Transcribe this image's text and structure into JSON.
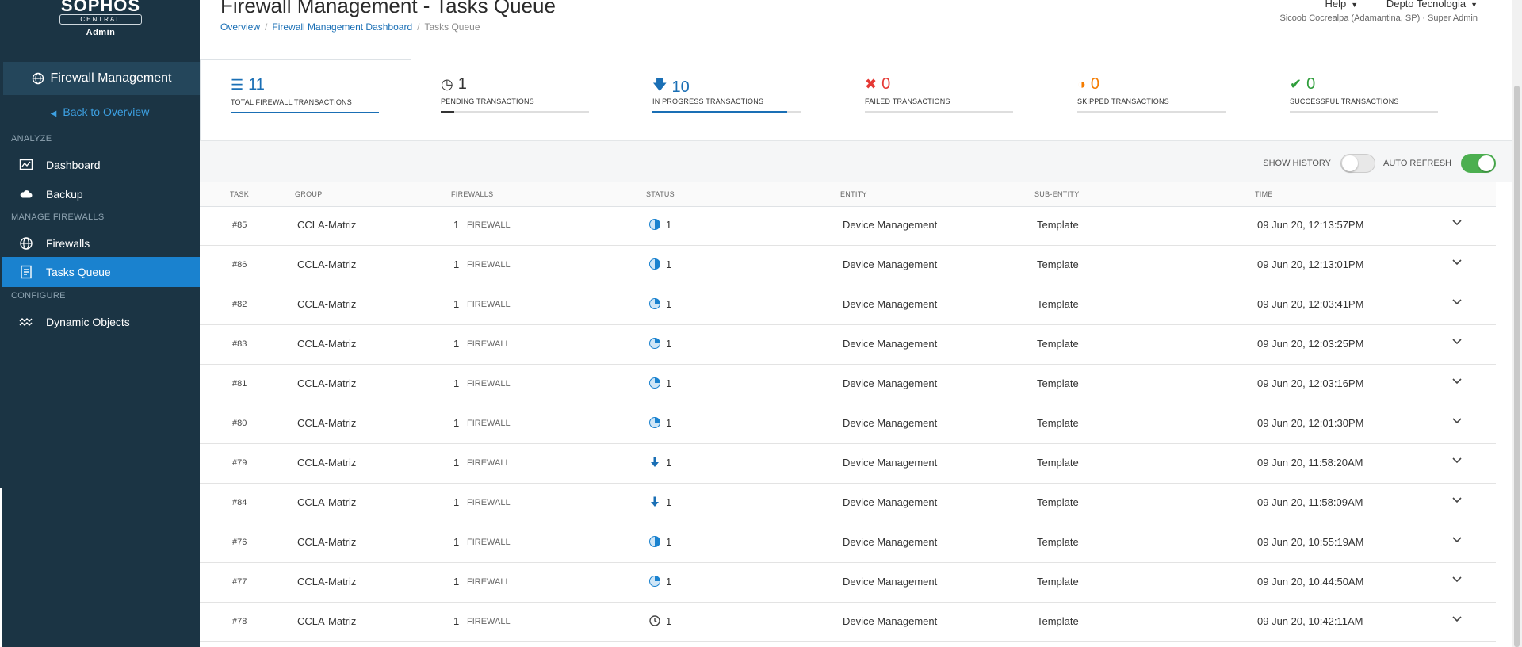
{
  "brand": {
    "logo": "SOPHOS",
    "sub": "CENTRAL",
    "role": "Admin"
  },
  "sidebar": {
    "module": "Firewall Management",
    "back": "Back to Overview",
    "sections": {
      "analyze": "ANALYZE",
      "manage": "MANAGE FIREWALLS",
      "configure": "CONFIGURE"
    },
    "items": [
      {
        "label": "Dashboard",
        "icon": "dashboard-icon"
      },
      {
        "label": "Backup",
        "icon": "cloud-icon"
      },
      {
        "label": "Firewalls",
        "icon": "globe-icon"
      },
      {
        "label": "Tasks Queue",
        "icon": "tasks-icon",
        "active": true
      },
      {
        "label": "Dynamic Objects",
        "icon": "wave-icon"
      }
    ]
  },
  "header": {
    "title": "Firewall Management - Tasks Queue",
    "breadcrumb": [
      "Overview",
      "Firewall Management Dashboard",
      "Tasks Queue"
    ],
    "help": "Help",
    "account": "Depto Tecnologia",
    "user": "Sicoob Cocrealpa (Adamantina, SP) · Super Admin"
  },
  "stats": [
    {
      "value": "11",
      "label": "TOTAL FIREWALL TRANSACTIONS",
      "icon": "list-icon",
      "color": "#1a6fb5",
      "fill": 1.0
    },
    {
      "value": "1",
      "label": "PENDING TRANSACTIONS",
      "icon": "clock-icon",
      "color": "#333333",
      "fill": 0.09
    },
    {
      "value": "10",
      "label": "IN PROGRESS TRANSACTIONS",
      "icon": "arrow-down-icon",
      "color": "#1a6fb5",
      "fill": 0.91
    },
    {
      "value": "0",
      "label": "FAILED TRANSACTIONS",
      "icon": "x-icon",
      "color": "#e53935",
      "fill": 0
    },
    {
      "value": "0",
      "label": "SKIPPED TRANSACTIONS",
      "icon": "half-circle-icon",
      "color": "#f57c00",
      "fill": 0
    },
    {
      "value": "0",
      "label": "SUCCESSFUL TRANSACTIONS",
      "icon": "check-icon",
      "color": "#2e9d3a",
      "fill": 0
    }
  ],
  "toolbar": {
    "show_history": "SHOW HISTORY",
    "show_history_on": false,
    "auto_refresh": "AUTO REFRESH",
    "auto_refresh_on": true
  },
  "table": {
    "headers": {
      "task": "TASK",
      "group": "GROUP",
      "firewalls": "FIREWALLS",
      "status": "STATUS",
      "entity": "ENTITY",
      "sub_entity": "SUB-ENTITY",
      "time": "TIME"
    },
    "rows": [
      {
        "task": "#85",
        "group": "CCLA-Matriz",
        "fw_count": "1",
        "fw_label": "FIREWALL",
        "status": "half",
        "status_count": "1",
        "entity": "Device Management",
        "sub_entity": "Template",
        "time": "09 Jun 20, 12:13:57PM"
      },
      {
        "task": "#86",
        "group": "CCLA-Matriz",
        "fw_count": "1",
        "fw_label": "FIREWALL",
        "status": "half",
        "status_count": "1",
        "entity": "Device Management",
        "sub_entity": "Template",
        "time": "09 Jun 20, 12:13:01PM"
      },
      {
        "task": "#82",
        "group": "CCLA-Matriz",
        "fw_count": "1",
        "fw_label": "FIREWALL",
        "status": "quarter",
        "status_count": "1",
        "entity": "Device Management",
        "sub_entity": "Template",
        "time": "09 Jun 20, 12:03:41PM"
      },
      {
        "task": "#83",
        "group": "CCLA-Matriz",
        "fw_count": "1",
        "fw_label": "FIREWALL",
        "status": "quarter",
        "status_count": "1",
        "entity": "Device Management",
        "sub_entity": "Template",
        "time": "09 Jun 20, 12:03:25PM"
      },
      {
        "task": "#81",
        "group": "CCLA-Matriz",
        "fw_count": "1",
        "fw_label": "FIREWALL",
        "status": "quarter",
        "status_count": "1",
        "entity": "Device Management",
        "sub_entity": "Template",
        "time": "09 Jun 20, 12:03:16PM"
      },
      {
        "task": "#80",
        "group": "CCLA-Matriz",
        "fw_count": "1",
        "fw_label": "FIREWALL",
        "status": "quarter",
        "status_count": "1",
        "entity": "Device Management",
        "sub_entity": "Template",
        "time": "09 Jun 20, 12:01:30PM"
      },
      {
        "task": "#79",
        "group": "CCLA-Matriz",
        "fw_count": "1",
        "fw_label": "FIREWALL",
        "status": "arrow",
        "status_count": "1",
        "entity": "Device Management",
        "sub_entity": "Template",
        "time": "09 Jun 20, 11:58:20AM"
      },
      {
        "task": "#84",
        "group": "CCLA-Matriz",
        "fw_count": "1",
        "fw_label": "FIREWALL",
        "status": "arrow",
        "status_count": "1",
        "entity": "Device Management",
        "sub_entity": "Template",
        "time": "09 Jun 20, 11:58:09AM"
      },
      {
        "task": "#76",
        "group": "CCLA-Matriz",
        "fw_count": "1",
        "fw_label": "FIREWALL",
        "status": "half",
        "status_count": "1",
        "entity": "Device Management",
        "sub_entity": "Template",
        "time": "09 Jun 20, 10:55:19AM"
      },
      {
        "task": "#77",
        "group": "CCLA-Matriz",
        "fw_count": "1",
        "fw_label": "FIREWALL",
        "status": "quarter",
        "status_count": "1",
        "entity": "Device Management",
        "sub_entity": "Template",
        "time": "09 Jun 20, 10:44:50AM"
      },
      {
        "task": "#78",
        "group": "CCLA-Matriz",
        "fw_count": "1",
        "fw_label": "FIREWALL",
        "status": "clock",
        "status_count": "1",
        "entity": "Device Management",
        "sub_entity": "Template",
        "time": "09 Jun 20, 10:42:11AM"
      }
    ]
  }
}
